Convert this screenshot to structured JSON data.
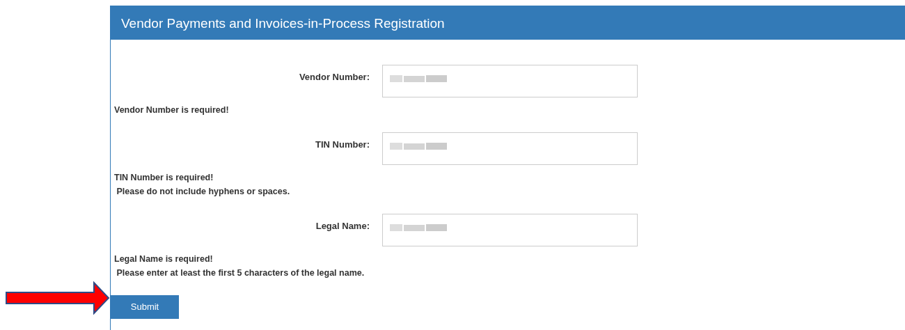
{
  "panel": {
    "title": "Vendor Payments and Invoices-in-Process Registration"
  },
  "fields": [
    {
      "label": "Vendor Number:",
      "redacted": true,
      "messages": [
        "Vendor Number is required!"
      ]
    },
    {
      "label": "TIN Number:",
      "redacted": true,
      "messages": [
        "TIN Number is required!",
        " Please do not include hyphens or spaces."
      ]
    },
    {
      "label": "Legal Name:",
      "redacted": true,
      "messages": [
        "Legal Name is required!",
        " Please enter at least the first 5 characters of the legal name."
      ]
    }
  ],
  "submit": {
    "label": "Submit"
  },
  "annotation": {
    "kind": "arrow"
  }
}
